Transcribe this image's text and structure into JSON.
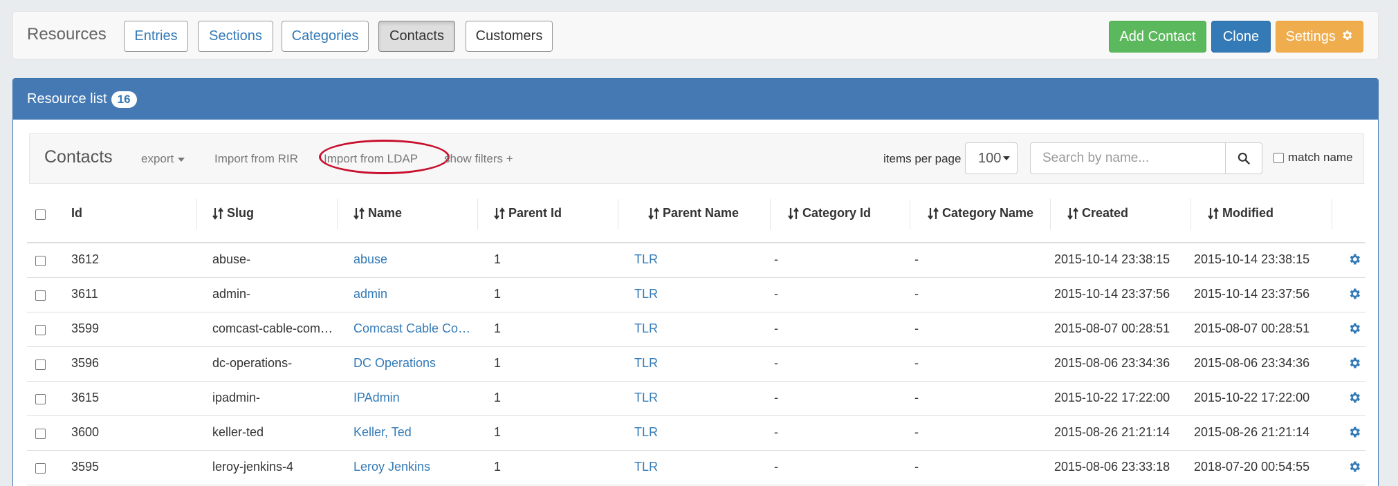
{
  "topbar": {
    "brand": "Resources",
    "tabs": [
      {
        "label": "Entries"
      },
      {
        "label": "Sections"
      },
      {
        "label": "Categories"
      },
      {
        "label": "Contacts"
      },
      {
        "label": "Customers"
      }
    ],
    "active_tab": "Contacts",
    "add_label": "Add Contact",
    "clone_label": "Clone",
    "settings_label": "Settings",
    "colors": {
      "add": "#5cb85c",
      "clone": "#337ab7",
      "settings": "#f0ad4e"
    }
  },
  "panel": {
    "title": "Resource list",
    "count": "16"
  },
  "toolbar": {
    "title": "Contacts",
    "export_label": "export",
    "import_rir": "Import from RIR",
    "import_ldap": "Import from LDAP",
    "show_filters": "show filters +",
    "items_per_page_label": "items per page",
    "items_per_page_value": "100",
    "search_placeholder": "Search by name...",
    "match_name": "match name",
    "highlight_color": "#c8102e"
  },
  "table": {
    "columns": [
      "Id",
      "Slug",
      "Name",
      "Parent Id",
      "Parent Name",
      "Category Id",
      "Category Name",
      "Created",
      "Modified"
    ],
    "rows": [
      {
        "id": "3612",
        "slug": "abuse-",
        "name": "abuse",
        "parent_id": "1",
        "parent_name": "TLR",
        "category_id": "-",
        "category_name": "-",
        "created": "2015-10-14 23:38:15",
        "modified": "2015-10-14 23:38:15"
      },
      {
        "id": "3611",
        "slug": "admin-",
        "name": "admin",
        "parent_id": "1",
        "parent_name": "TLR",
        "category_id": "-",
        "category_name": "-",
        "created": "2015-10-14 23:37:56",
        "modified": "2015-10-14 23:37:56"
      },
      {
        "id": "3599",
        "slug": "comcast-cable-com…",
        "name": "Comcast Cable Co…",
        "parent_id": "1",
        "parent_name": "TLR",
        "category_id": "-",
        "category_name": "-",
        "created": "2015-08-07 00:28:51",
        "modified": "2015-08-07 00:28:51"
      },
      {
        "id": "3596",
        "slug": "dc-operations-",
        "name": "DC Operations",
        "parent_id": "1",
        "parent_name": "TLR",
        "category_id": "-",
        "category_name": "-",
        "created": "2015-08-06 23:34:36",
        "modified": "2015-08-06 23:34:36"
      },
      {
        "id": "3615",
        "slug": "ipadmin-",
        "name": "IPAdmin",
        "parent_id": "1",
        "parent_name": "TLR",
        "category_id": "-",
        "category_name": "-",
        "created": "2015-10-22 17:22:00",
        "modified": "2015-10-22 17:22:00"
      },
      {
        "id": "3600",
        "slug": "keller-ted",
        "name": "Keller, Ted",
        "parent_id": "1",
        "parent_name": "TLR",
        "category_id": "-",
        "category_name": "-",
        "created": "2015-08-26 21:21:14",
        "modified": "2015-08-26 21:21:14"
      },
      {
        "id": "3595",
        "slug": "leroy-jenkins-4",
        "name": "Leroy Jenkins",
        "parent_id": "1",
        "parent_name": "TLR",
        "category_id": "-",
        "category_name": "-",
        "created": "2015-08-06 23:33:18",
        "modified": "2018-07-20 00:54:55"
      }
    ]
  }
}
